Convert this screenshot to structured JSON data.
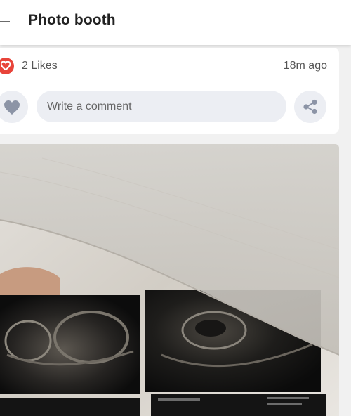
{
  "header": {
    "title": "Photo booth"
  },
  "post": {
    "likes": "2 Likes",
    "time": "18m ago",
    "comment_placeholder": "Write a comment"
  },
  "colors": {
    "like_red": "#e8443a",
    "icon_grey": "#8c94a6",
    "pill_bg": "#eceef3"
  },
  "icons": [
    "back-arrow-icon",
    "heart-icon",
    "share-icon"
  ]
}
